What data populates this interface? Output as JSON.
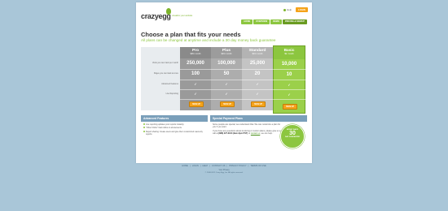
{
  "header": {
    "logo": "crazyegg",
    "tagline": "visualize your website",
    "help": "Help",
    "login": "LOGIN"
  },
  "nav": [
    "HOME",
    "OVERVIEW",
    "DEMO",
    "PRICING & SIGNUP"
  ],
  "headline": "Choose a plan that fits your needs",
  "subhead": "All plans can be changed at anytime and include a 30 day money back guarantee",
  "pricing": {
    "row_labels": [
      "Visits you can track per month",
      "Pages you can track at once",
      "Advanced Features",
      "Live Reporting"
    ],
    "plans": [
      {
        "name": "Pro",
        "price": "$99 / month",
        "visits": "250,000",
        "pages": "100",
        "signup": "SIGN UP"
      },
      {
        "name": "Plus",
        "price": "$49 / month",
        "visits": "100,000",
        "pages": "50",
        "signup": "SIGN UP"
      },
      {
        "name": "Standard",
        "price": "$19 / month",
        "visits": "25,000",
        "pages": "20",
        "signup": "SIGN UP"
      },
      {
        "name": "Basic",
        "price": "$9 / month",
        "visits": "10,000",
        "pages": "10",
        "signup": "SIGN UP"
      }
    ],
    "check": "✓"
  },
  "advanced": {
    "title": "Advanced Features",
    "items": [
      "Live reporting updates your reports instantly.",
      "\"Other Clicks\" track clicks on all elements.",
      "Report sharing: Create users and give them customized read-only reports."
    ]
  },
  "special": {
    "title": "Special Payment Plans",
    "text1": "Some people are special, we understand that. We can customize a plan for you if you want.",
    "text2": "If you have any questions about invoicing or custom plans, please give us a call at",
    "phone": "(888) 227-3913 (9am-6pm PST)",
    "or": "or",
    "contact": "contact us",
    "text3": ", we can help.",
    "badge_top": "MONEY BACK",
    "badge_num": "30",
    "badge_bottom": "DAY GUARANTEE"
  },
  "footer": {
    "links": [
      "HOME",
      "LOGIN",
      "HELP",
      "CONTACT US",
      "PRIVACY POLICY",
      "TERMS OF USE"
    ],
    "privacy": "Your Privacy",
    "copyright": "© 2008-2011 Crazy Egg, Inc. All rights reserved."
  }
}
